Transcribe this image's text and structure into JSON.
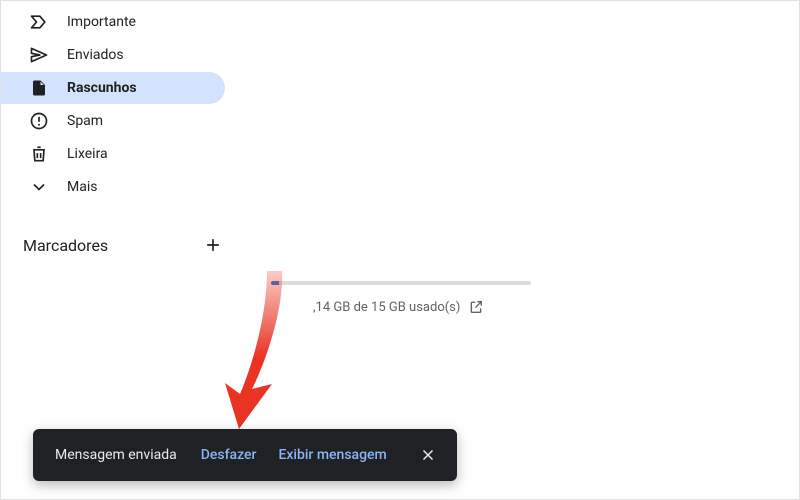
{
  "sidebar": {
    "items": [
      {
        "label": "Importante"
      },
      {
        "label": "Enviados"
      },
      {
        "label": "Rascunhos"
      },
      {
        "label": "Spam"
      },
      {
        "label": "Lixeira"
      },
      {
        "label": "Mais"
      }
    ],
    "labels_header": "Marcadores"
  },
  "storage": {
    "text": ",14 GB de 15 GB usado(s)",
    "used_gb": 0.14,
    "total_gb": 15
  },
  "toast": {
    "message": "Mensagem enviada",
    "undo": "Desfazer",
    "view": "Exibir mensagem"
  }
}
